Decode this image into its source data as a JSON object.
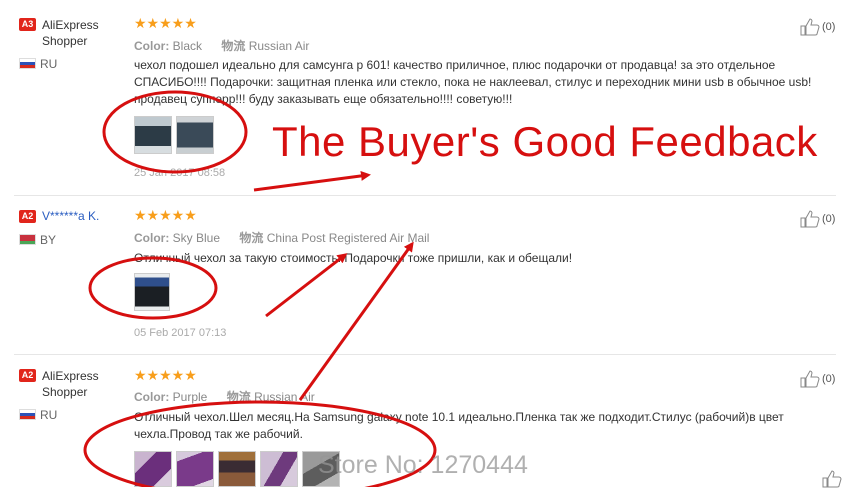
{
  "reviews": [
    {
      "badge": "A3",
      "user": "AliExpress Shopper",
      "country": "RU",
      "stars": "★★★★★",
      "color_label": "Color:",
      "color_value": "Black",
      "shipping_label": "物流",
      "shipping_value": "Russian Air",
      "text": "чехол подошел идеально для самсунга р 601! качество приличное, плюс подарочки от продавца! за это отдельное СПАСИБО!!!! Подарочки: защитная пленка или стекло, пока не наклеевал, стилус и переходник мини usb в обычное usb! продавец супперр!!! буду заказывать еще обязательно!!!! советую!!!",
      "date": "25 Jan 2017 08:58",
      "likes": "(0)"
    },
    {
      "badge": "A2",
      "user": "V******a K.",
      "country": "BY",
      "stars": "★★★★★",
      "color_label": "Color:",
      "color_value": "Sky Blue",
      "shipping_label": "物流",
      "shipping_value": "China Post Registered Air Mail",
      "text": "Отличный чехол за такую стоимость. Подарочки тоже пришли, как и обещали!",
      "date": "05 Feb 2017 07:13",
      "likes": "(0)"
    },
    {
      "badge": "A2",
      "user": "AliExpress Shopper",
      "country": "RU",
      "stars": "★★★★★",
      "color_label": "Color:",
      "color_value": "Purple",
      "shipping_label": "物流",
      "shipping_value": "Russian Air",
      "text": "Отличный чехол.Шел месяц.На Samsung galaxy note 10.1 идеально.Пленка так же подходит.Стилус (рабочий)в цвет чехла.Провод так же рабочий.",
      "likes": "(0)"
    }
  ],
  "overlay": {
    "banner": "The Buyer's Good Feedback",
    "watermark": "Store No: 1270444"
  },
  "colors": {
    "annotation_red": "#d60f0f",
    "star_orange": "#f89e1b",
    "badge_red": "#e1251b"
  }
}
